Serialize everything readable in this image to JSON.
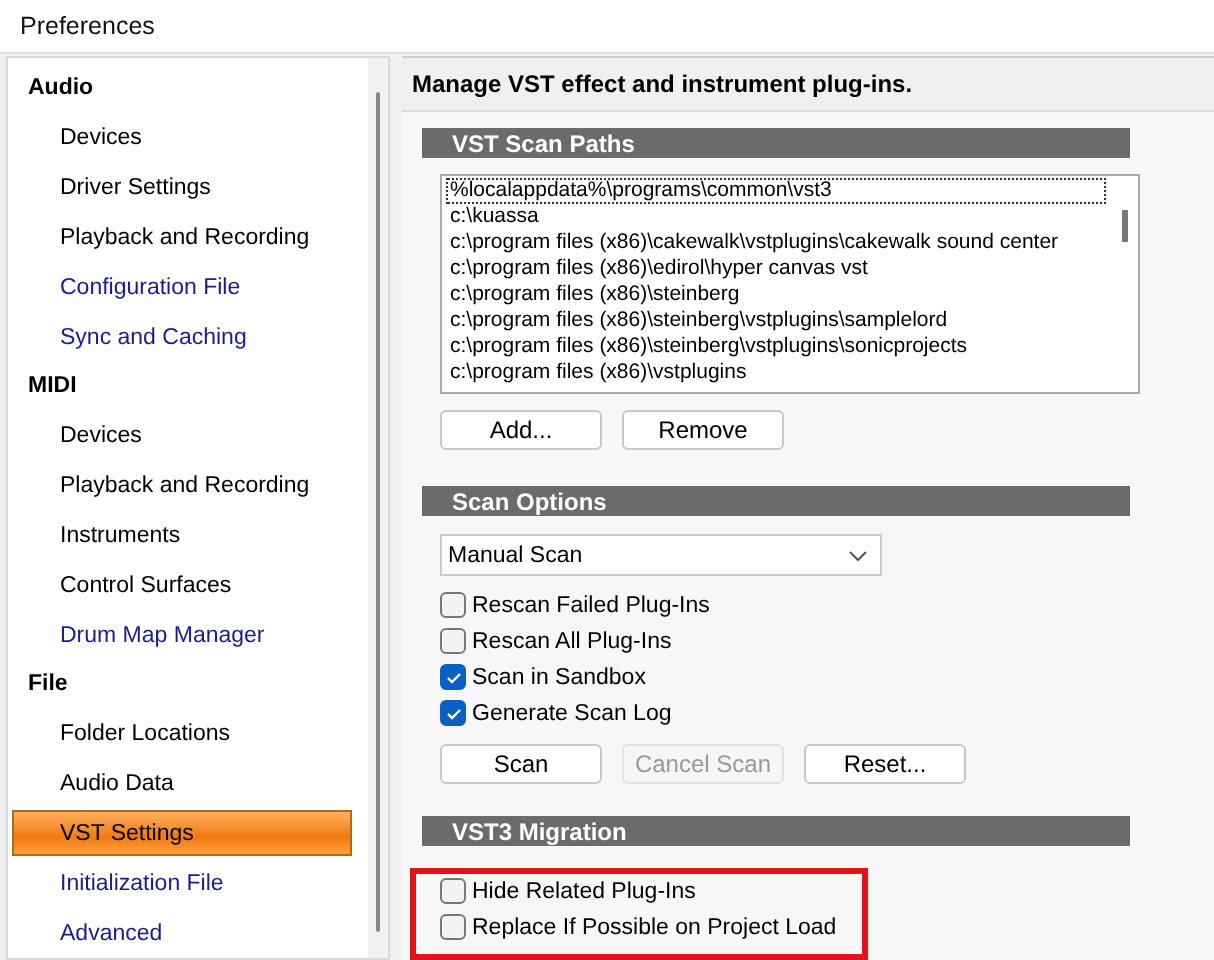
{
  "window": {
    "title": "Preferences"
  },
  "sidebar": {
    "groups": [
      {
        "label": "Audio",
        "items": [
          {
            "label": "Devices",
            "kind": "page",
            "selected": false
          },
          {
            "label": "Driver Settings",
            "kind": "page",
            "selected": false
          },
          {
            "label": "Playback and Recording",
            "kind": "page",
            "selected": false
          },
          {
            "label": "Configuration File",
            "kind": "link",
            "selected": false
          },
          {
            "label": "Sync and Caching",
            "kind": "link",
            "selected": false
          }
        ]
      },
      {
        "label": "MIDI",
        "items": [
          {
            "label": "Devices",
            "kind": "page",
            "selected": false
          },
          {
            "label": "Playback and Recording",
            "kind": "page",
            "selected": false
          },
          {
            "label": "Instruments",
            "kind": "page",
            "selected": false
          },
          {
            "label": "Control Surfaces",
            "kind": "page",
            "selected": false
          },
          {
            "label": "Drum Map Manager",
            "kind": "link",
            "selected": false
          }
        ]
      },
      {
        "label": "File",
        "items": [
          {
            "label": "Folder Locations",
            "kind": "page",
            "selected": false
          },
          {
            "label": "Audio Data",
            "kind": "page",
            "selected": false
          },
          {
            "label": "VST Settings",
            "kind": "page",
            "selected": true
          },
          {
            "label": "Initialization File",
            "kind": "link",
            "selected": false
          },
          {
            "label": "Advanced",
            "kind": "link",
            "selected": false
          }
        ]
      }
    ]
  },
  "header": "Manage VST effect and instrument plug-ins.",
  "scan_paths": {
    "title": "VST Scan Paths",
    "paths": [
      {
        "label": "%localappdata%\\programs\\common\\vst3",
        "selected": true
      },
      {
        "label": "c:\\kuassa",
        "selected": false
      },
      {
        "label": "c:\\program files (x86)\\cakewalk\\vstplugins\\cakewalk sound center",
        "selected": false
      },
      {
        "label": "c:\\program files (x86)\\edirol\\hyper canvas vst",
        "selected": false
      },
      {
        "label": "c:\\program files (x86)\\steinberg",
        "selected": false
      },
      {
        "label": "c:\\program files (x86)\\steinberg\\vstplugins\\samplelord",
        "selected": false
      },
      {
        "label": "c:\\program files (x86)\\steinberg\\vstplugins\\sonicprojects",
        "selected": false
      },
      {
        "label": "c:\\program files (x86)\\vstplugins",
        "selected": false
      }
    ],
    "buttons": [
      {
        "label": "Add...",
        "disabled": false
      },
      {
        "label": "Remove",
        "disabled": false
      }
    ]
  },
  "scan_options": {
    "title": "Scan Options",
    "mode": "Manual Scan",
    "options": [
      {
        "label": "Rescan Failed Plug-Ins",
        "checked": false
      },
      {
        "label": "Rescan All Plug-Ins",
        "checked": false
      },
      {
        "label": "Scan in Sandbox",
        "checked": true
      },
      {
        "label": "Generate Scan Log",
        "checked": true
      }
    ],
    "buttons": [
      {
        "label": "Scan",
        "disabled": false
      },
      {
        "label": "Cancel Scan",
        "disabled": true
      },
      {
        "label": "Reset...",
        "disabled": false
      }
    ]
  },
  "migration": {
    "title": "VST3 Migration",
    "options": [
      {
        "label": "Hide Related Plug-Ins",
        "checked": false
      },
      {
        "label": "Replace If Possible on Project Load",
        "checked": false
      }
    ]
  }
}
